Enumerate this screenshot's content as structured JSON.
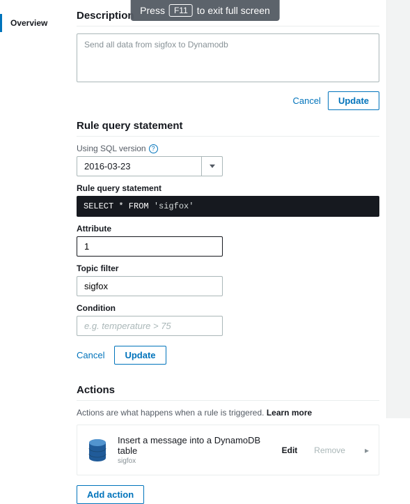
{
  "fullscreen": {
    "prefix": "Press",
    "key": "F11",
    "suffix": "to exit full screen"
  },
  "nav": {
    "overview": "Overview"
  },
  "description": {
    "heading": "Description",
    "value": "Send all data from sigfox to Dynamodb",
    "cancel": "Cancel",
    "update": "Update"
  },
  "rqs": {
    "heading": "Rule query statement",
    "sql_version_label": "Using SQL version",
    "sql_version_value": "2016-03-23",
    "statement_label": "Rule query statement",
    "statement_kw": "SELECT * FROM",
    "statement_str": "'sigfox'",
    "attribute_label": "Attribute",
    "attribute_value": "1",
    "topic_label": "Topic filter",
    "topic_value": "sigfox",
    "condition_label": "Condition",
    "condition_placeholder": "e.g. temperature > 75",
    "cancel": "Cancel",
    "update": "Update"
  },
  "actions": {
    "heading": "Actions",
    "help_text": "Actions are what happens when a rule is triggered. ",
    "learn_more": "Learn more",
    "item": {
      "title": "Insert a message into a DynamoDB table",
      "sub": "sigfox",
      "edit": "Edit",
      "remove": "Remove"
    },
    "add": "Add action"
  }
}
